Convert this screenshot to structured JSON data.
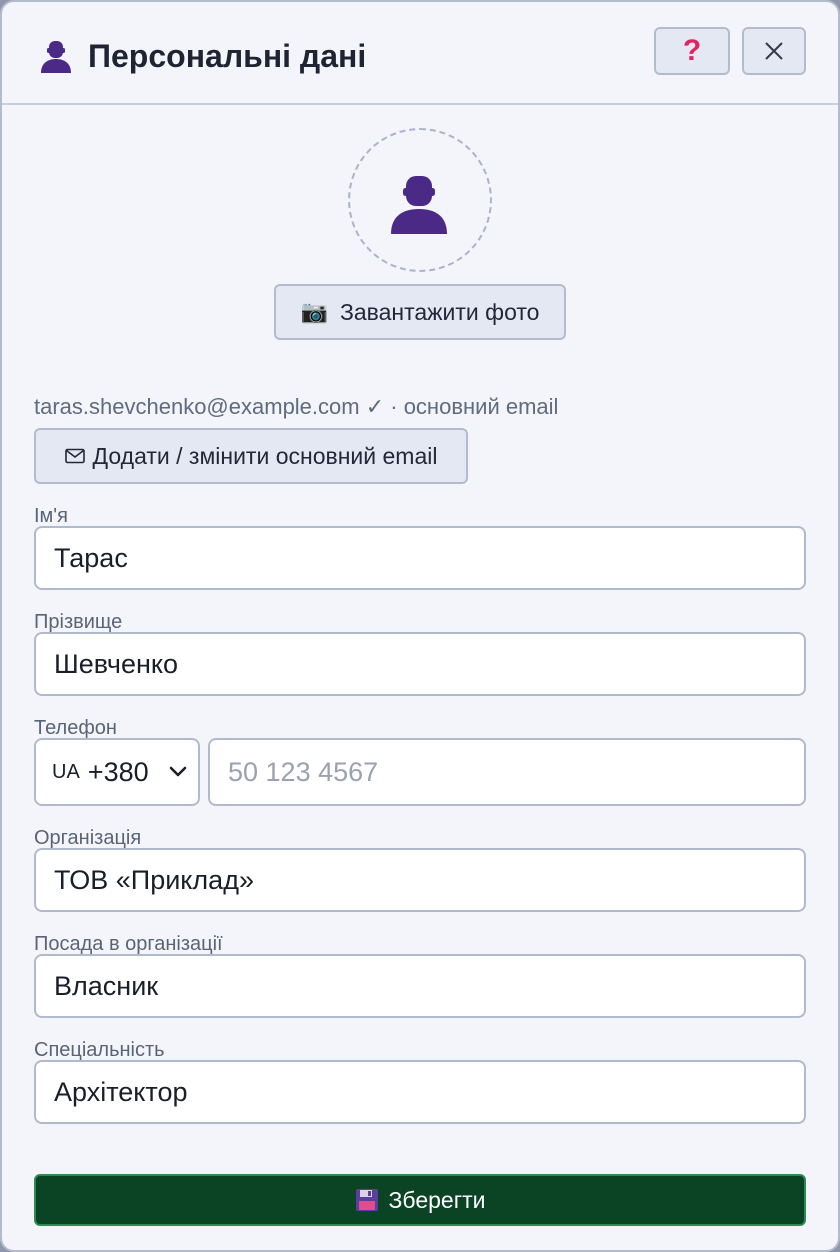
{
  "header": {
    "title": "Персональні дані",
    "title_icon": "person-icon",
    "help_icon": "question-icon",
    "close_icon": "close-icon"
  },
  "avatar": {
    "icon": "person-icon",
    "upload_icon": "camera-icon",
    "upload_label": "Завантажити фото"
  },
  "email": {
    "address_line": "taras.shevchenko@example.com ✓ · основний email",
    "button_icon": "envelope-icon",
    "button_label": "Додати / змінити основний email"
  },
  "fields": {
    "first_name": {
      "label": "Ім'я",
      "value": "Тарас"
    },
    "last_name": {
      "label": "Прізвище",
      "value": "Шевченко"
    },
    "phone": {
      "label": "Телефон",
      "country_code": "UA",
      "dial_code": "+380",
      "placeholder": "50 123 4567"
    },
    "organization": {
      "label": "Організація",
      "value": "ТОВ «Приклад»"
    },
    "position": {
      "label": "Посада в організації",
      "value": "Власник"
    },
    "specialty": {
      "label": "Спеціальність",
      "value": "Архітектор"
    }
  },
  "footer": {
    "save_icon": "floppy-disk-icon",
    "save_label": "Зберегти"
  },
  "colors": {
    "background": "#f3f5fa",
    "save_button": "#0b4425",
    "accent_purple": "#4a2a86",
    "help_icon": "#e0245e"
  }
}
